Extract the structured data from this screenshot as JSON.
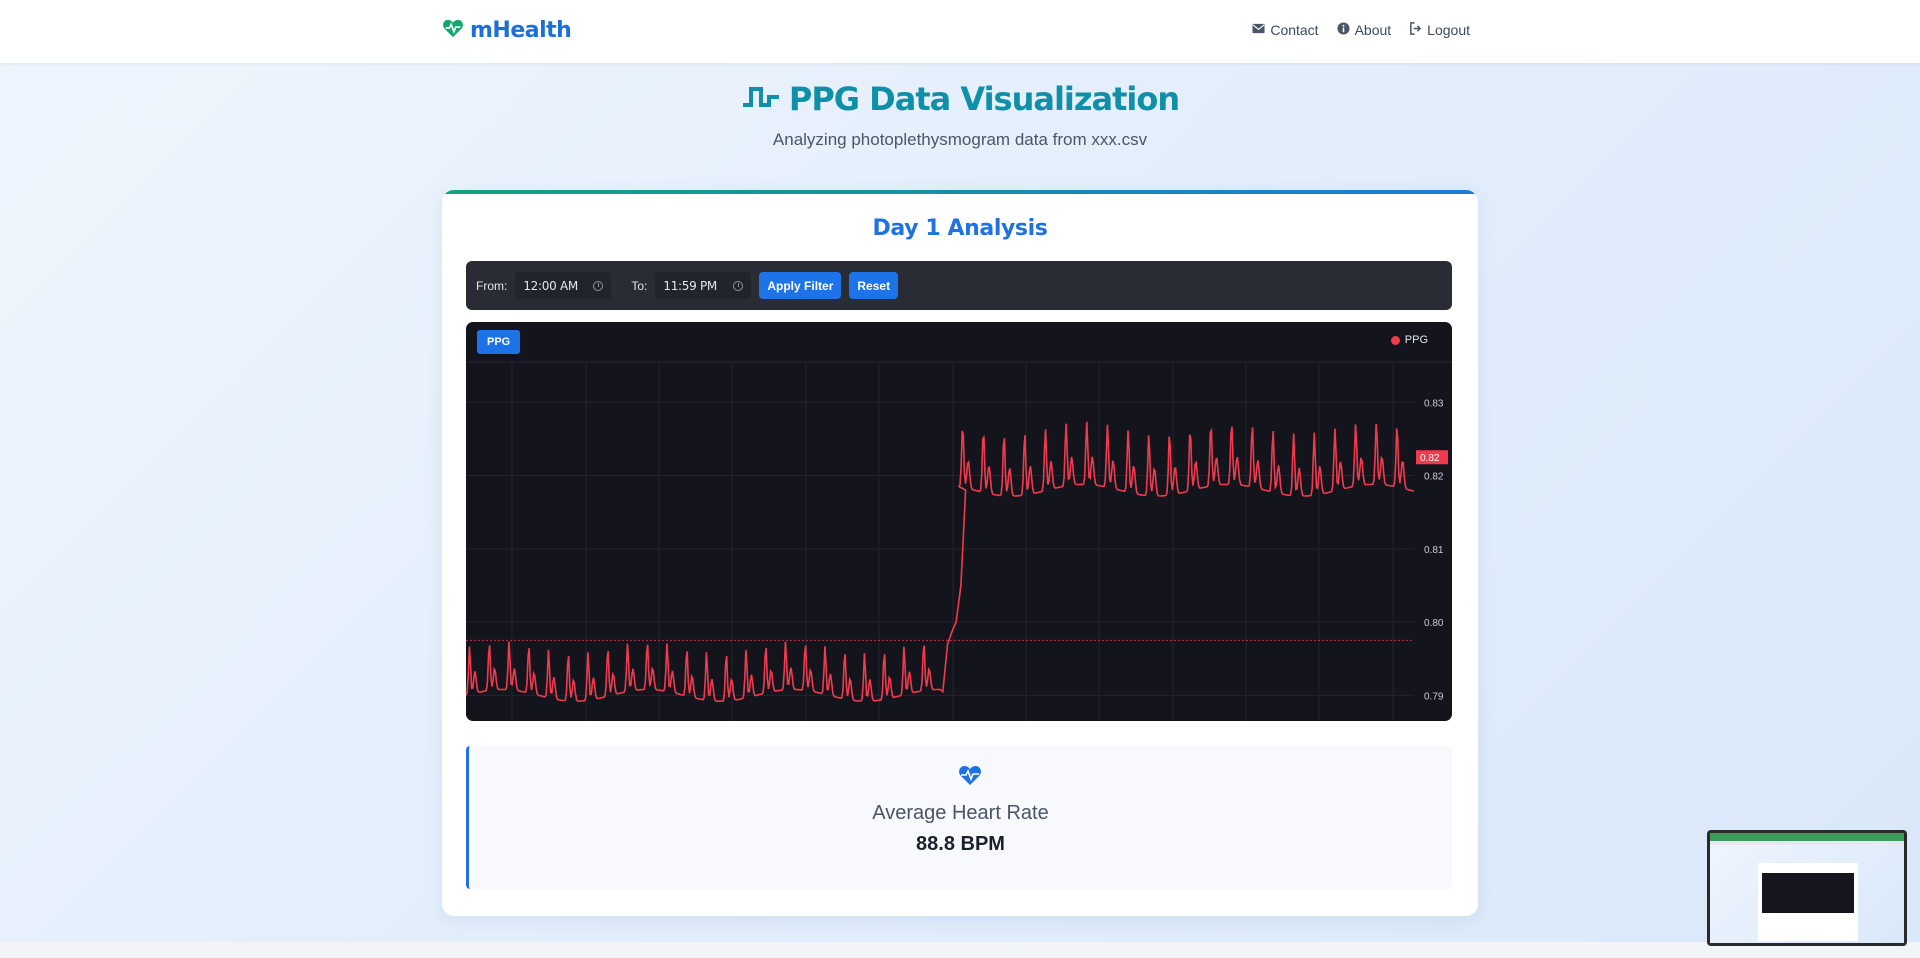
{
  "nav": {
    "brand": "mHealth",
    "links": [
      {
        "label": "Contact",
        "icon": "envelope-icon"
      },
      {
        "label": "About",
        "icon": "info-icon"
      },
      {
        "label": "Logout",
        "icon": "logout-icon"
      }
    ]
  },
  "header": {
    "title": "PPG Data Visualization",
    "subtitle": "Analyzing photoplethysmogram data from xxx.csv"
  },
  "card": {
    "title": "Day 1 Analysis",
    "filter": {
      "from_label": "From:",
      "from_value": "12:00 AM",
      "to_label": "To:",
      "to_value": "11:59 PM",
      "apply_label": "Apply Filter",
      "reset_label": "Reset"
    },
    "chart": {
      "tab_label": "PPG",
      "legend_label": "PPG",
      "last_value_label": "0.82"
    },
    "heart_rate": {
      "label": "Average Heart Rate",
      "value": "88.8 BPM"
    }
  },
  "colors": {
    "brand": "#1d6fd8",
    "title": "#0f8fa8",
    "accent": "#1c74e8",
    "series": "#f23a4f",
    "chart_bg": "#14151c"
  },
  "chart_data": {
    "type": "line",
    "series": [
      {
        "name": "PPG",
        "color": "#f23a4f",
        "segments": [
          {
            "x_range": [
              0,
              0.5
            ],
            "base": 0.7935,
            "amplitude": 0.0035,
            "beats": 24
          },
          {
            "x_range": [
              0.52,
              1.0
            ],
            "base": 0.8225,
            "amplitude": 0.0045,
            "beats": 22
          }
        ]
      }
    ],
    "y_ticks": [
      0.79,
      0.8,
      0.81,
      0.82,
      0.83
    ],
    "ylim": [
      0.7865,
      0.8355
    ],
    "last_value": 0.8225,
    "price_line": 0.7975,
    "grid": true,
    "legend": "top-right"
  }
}
